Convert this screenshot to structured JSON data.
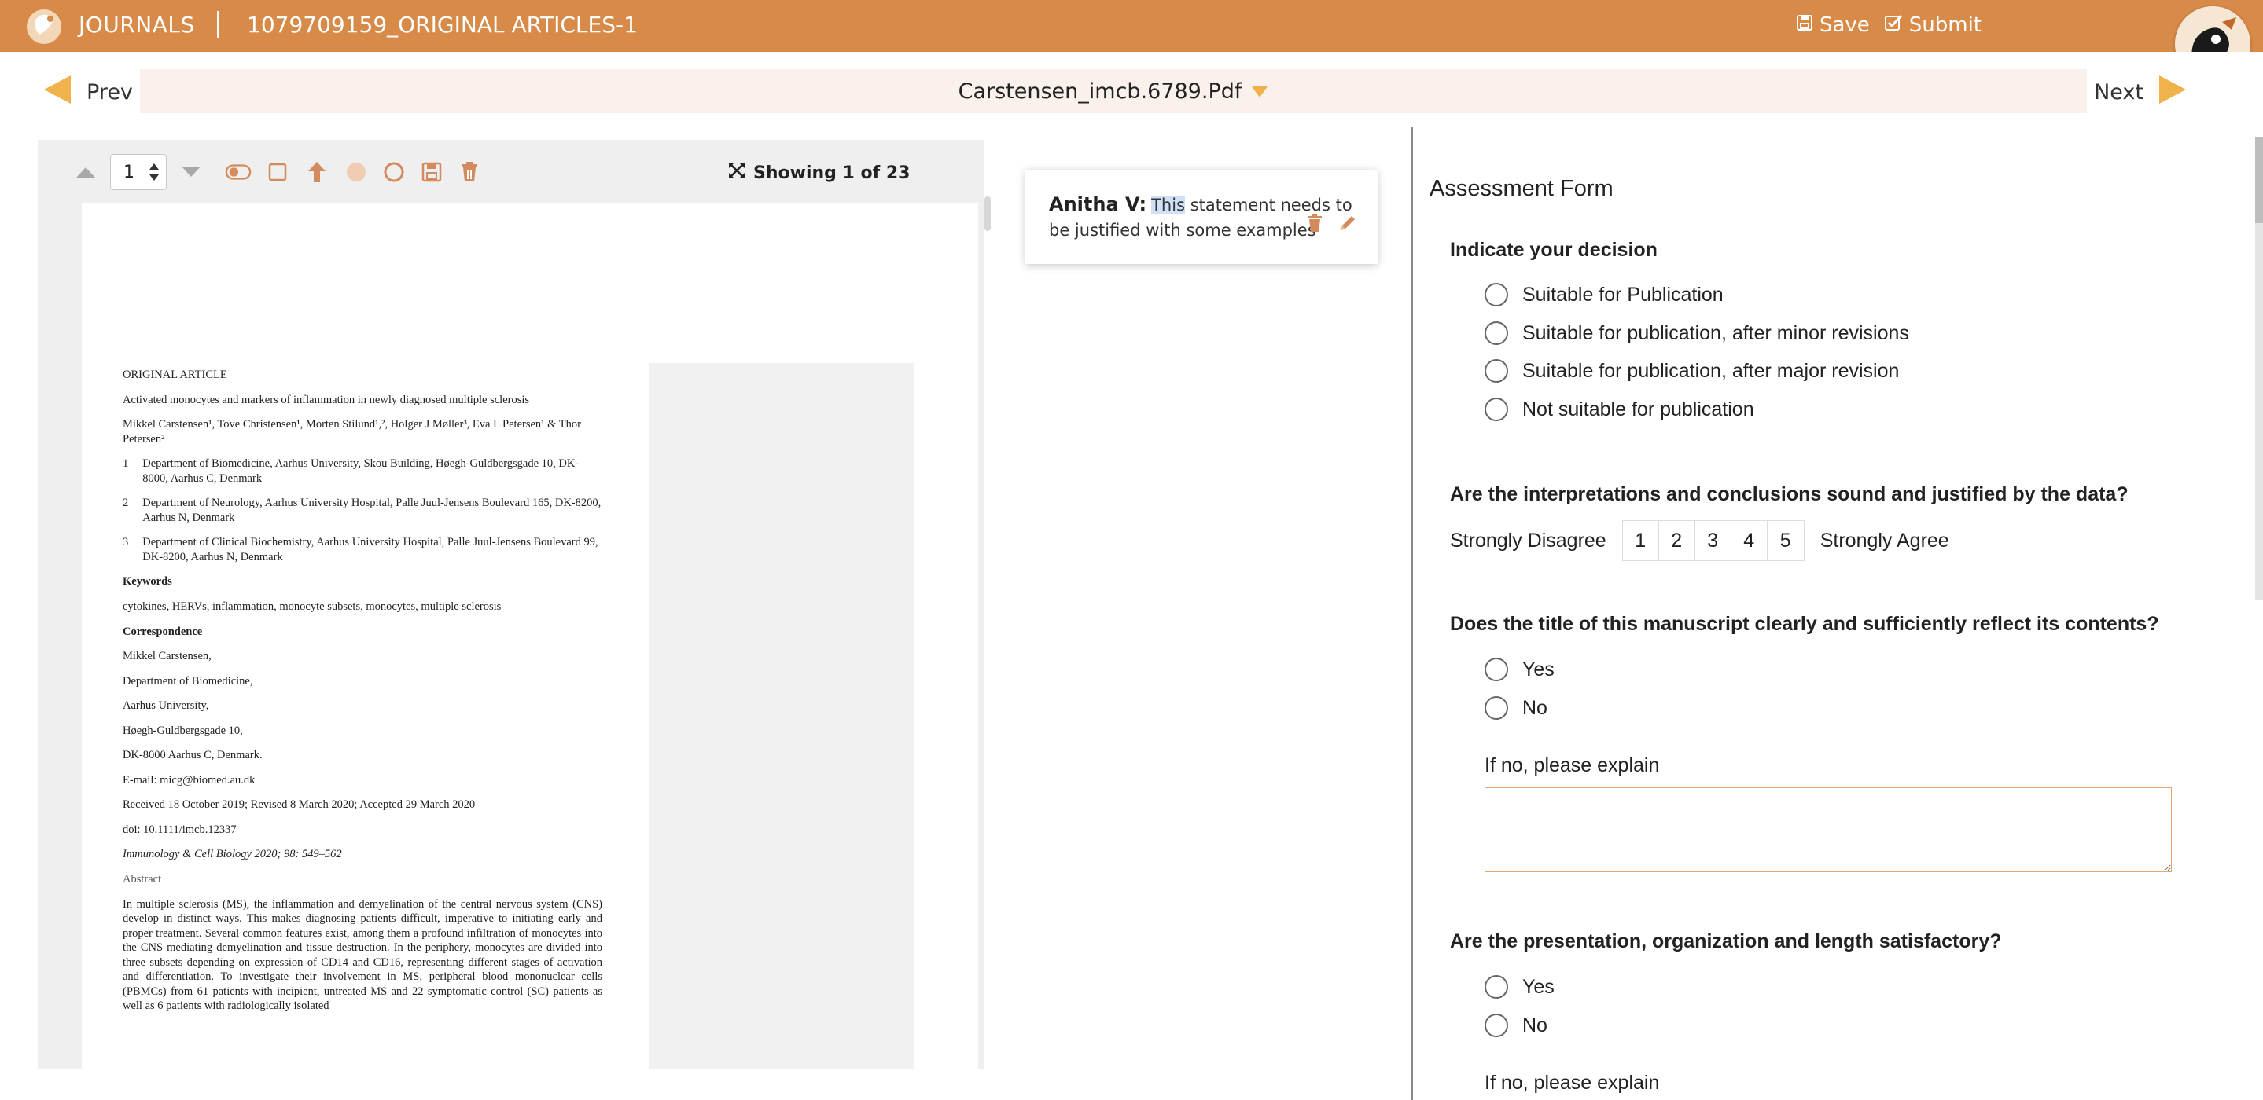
{
  "header": {
    "brand": "JOURNALS",
    "document_title": "1079709159_ORIGINAL ARTICLES-1",
    "save_label": "Save",
    "submit_label": "Submit",
    "accent_color": "#d88a48"
  },
  "nav": {
    "prev_label": "Prev",
    "next_label": "Next",
    "file_name": "Carstensen_imcb.6789.Pdf"
  },
  "viewer": {
    "page_number": "1",
    "showing_text": "Showing 1 of 23"
  },
  "article": {
    "type": "ORIGINAL ARTICLE",
    "title": "Activated monocytes and markers of inflammation in newly diagnosed multiple sclerosis",
    "authors": "Mikkel Carstensen¹, Tove Christensen¹, Morten Stilund¹,², Holger J Møller³, Eva L Petersen¹ & Thor Petersen²",
    "affiliations": [
      {
        "num": "1",
        "text": "Department of Biomedicine, Aarhus University, Skou Building, Høegh-Guldbergsgade 10, DK-8000, Aarhus C, Denmark"
      },
      {
        "num": "2",
        "text": "Department of Neurology, Aarhus University Hospital, Palle Juul-Jensens Boulevard 165, DK-8200, Aarhus N, Denmark"
      },
      {
        "num": "3",
        "text": "Department of Clinical Biochemistry, Aarhus University Hospital, Palle Juul-Jensens Boulevard 99, DK-8200, Aarhus N, Denmark"
      }
    ],
    "keywords_head": "Keywords",
    "keywords": "cytokines, HERVs, inflammation, monocyte subsets, monocytes, multiple sclerosis",
    "correspondence_head": "Correspondence",
    "correspondence": [
      "Mikkel Carstensen,",
      "Department of Biomedicine,",
      "Aarhus University,",
      "Høegh-Guldbergsgade 10,",
      "DK-8000 Aarhus C, Denmark."
    ],
    "email": "E-mail: micg@biomed.au.dk",
    "dates": "Received 18 October 2019; Revised 8 March 2020; Accepted 29 March 2020",
    "doi": "doi: 10.1111/imcb.12337",
    "journal": "Immunology & Cell Biology 2020; 98: 549–562",
    "abstract_head": "Abstract",
    "abstract": "In multiple sclerosis (MS), the inflammation and demyelination of the central nervous system (CNS) develop in distinct ways. This makes diagnosing patients difficult, imperative to initiating early and proper treatment. Several common features exist, among them a profound infiltration of monocytes into the CNS mediating demyelination and tissue destruction. In the periphery, monocytes are divided into three subsets depending on expression of CD14 and CD16, representing different stages of activation and differentiation. To investigate their involvement in MS, peripheral blood mononuclear cells (PBMCs) from 61 patients with incipient, untreated MS and 22 symptomatic control (SC) patients as well as 6 patients with radiologically isolated"
  },
  "comment": {
    "author": "Anitha V:",
    "highlight": "This",
    "text": " statement needs to be justified with some examples"
  },
  "form": {
    "title": "Assessment Form",
    "q1": {
      "label": "Indicate your decision",
      "options": [
        "Suitable for Publication",
        "Suitable for publication, after minor revisions",
        "Suitable for publication, after major revision",
        "Not suitable for publication"
      ]
    },
    "q2": {
      "label": "Are the interpretations and conclusions sound and justified by the data?",
      "low": "Strongly Disagree",
      "high": "Strongly Agree",
      "scale": [
        "1",
        "2",
        "3",
        "4",
        "5"
      ]
    },
    "q3": {
      "label": "Does the title of this manuscript clearly and sufficiently reflect its contents?",
      "options": [
        "Yes",
        "No"
      ],
      "explain": "If no, please explain"
    },
    "q4": {
      "label": "Are the presentation, organization and length satisfactory?",
      "options": [
        "Yes",
        "No"
      ],
      "explain": "If no, please explain"
    }
  }
}
